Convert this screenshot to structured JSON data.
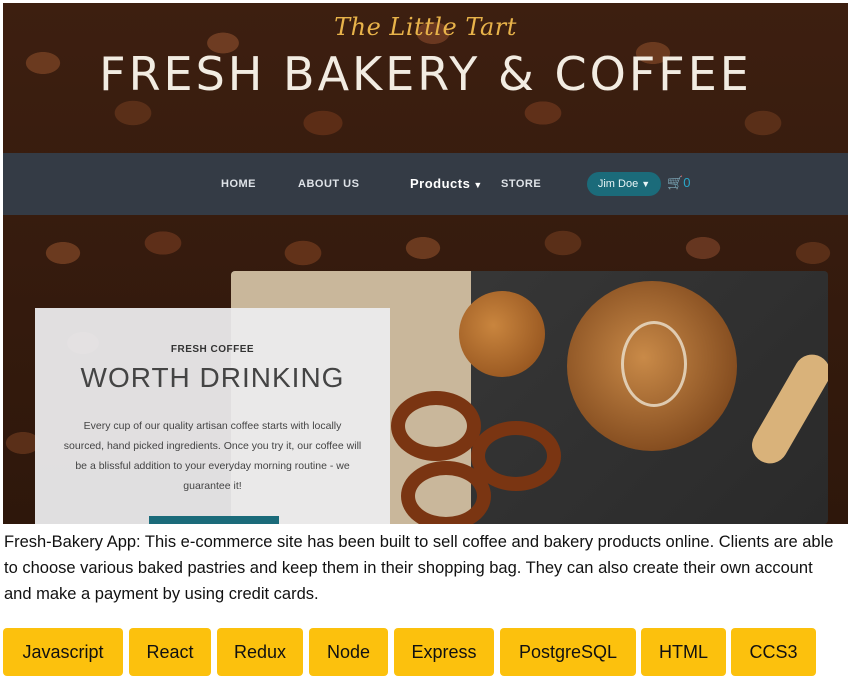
{
  "hero": {
    "brand_script": "The Little Tart",
    "brand_title": "FRESH BAKERY & COFFEE",
    "nav": {
      "home": "HOME",
      "about": "ABOUT US",
      "products": "Products",
      "store": "STORE",
      "user": "Jim Doe",
      "cart_count": "0"
    },
    "card": {
      "kicker": "FRESH COFFEE",
      "heading": "WORTH DRINKING",
      "text": "Every cup of our quality artisan coffee starts with locally sourced, hand picked ingredients. Once you try it, our coffee will be a blissful addition to your everyday morning routine - we guarantee it!"
    }
  },
  "description": "Fresh-Bakery App: This e-commerce site has been built to sell coffee and bakery products online. Clients are able to choose various baked pastries and keep them in their shopping bag. They can also create their own account and make a payment by using credit cards.",
  "tags": [
    "Javascript",
    "React",
    "Redux",
    "Node",
    "Express",
    "PostgreSQL",
    "HTML",
    "CCS3"
  ],
  "colors": {
    "tag_bg": "#fcc10d",
    "nav_bg": "#343e4a",
    "accent_teal": "#1b6b7a",
    "brand_gold": "#e8b34a"
  },
  "icons": [
    "caret-down-icon",
    "shopping-cart-icon"
  ]
}
